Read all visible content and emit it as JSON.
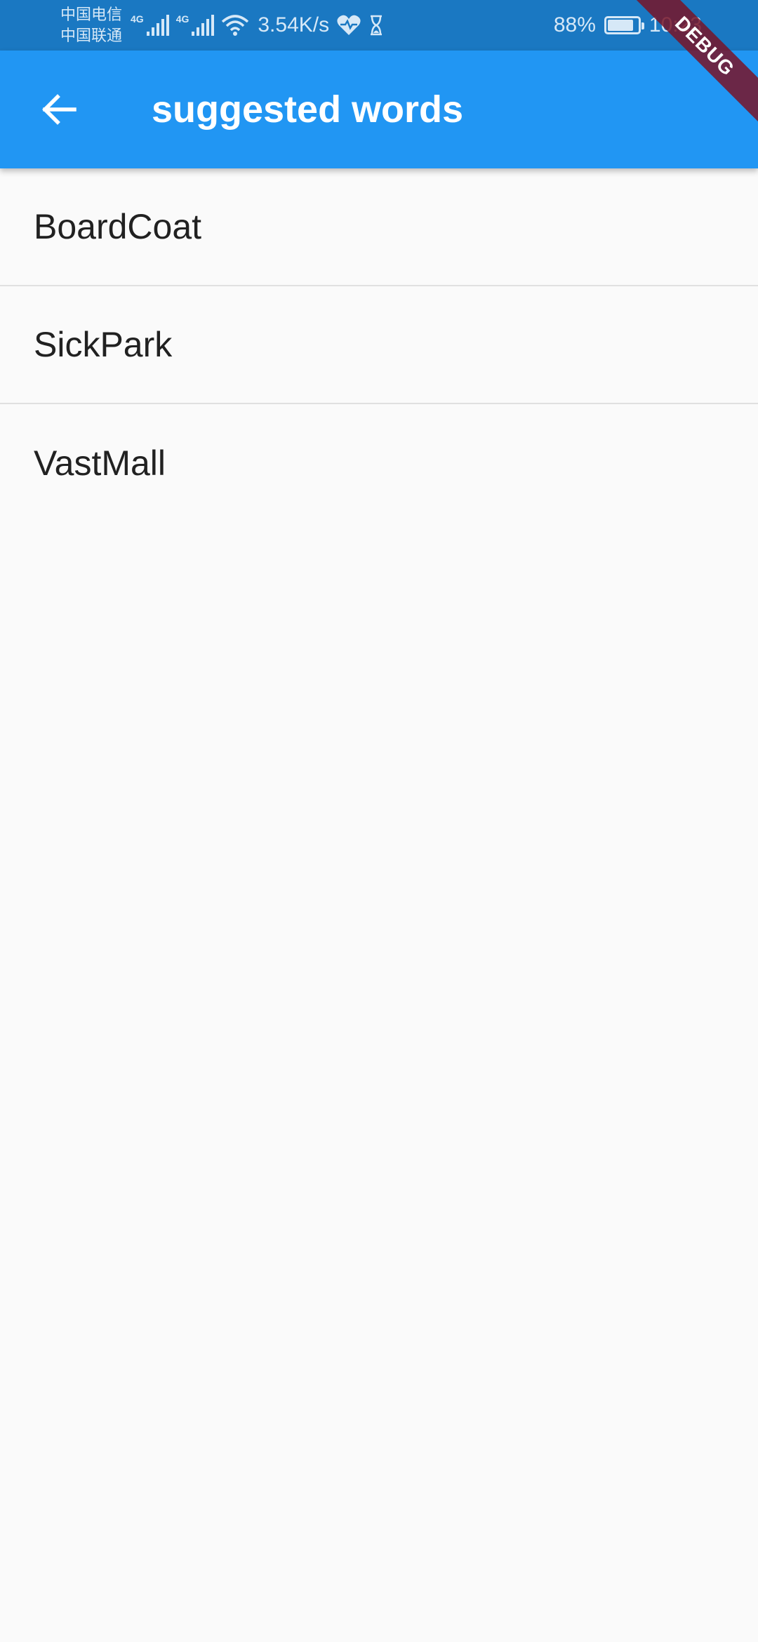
{
  "status_bar": {
    "carrier_1": "中国电信",
    "carrier_2": "中国联通",
    "signal_1_tag": "4G",
    "signal_2_tag": "4G",
    "net_speed": "3.54K/s",
    "battery_text": "88%",
    "battery_level": 0.88,
    "time": "10:23"
  },
  "app_bar": {
    "title": "suggested words",
    "color": "#2196f3"
  },
  "debug_banner": "DEBUG",
  "list": {
    "items": [
      {
        "label": "BoardCoat"
      },
      {
        "label": "SickPark"
      },
      {
        "label": "VastMall"
      }
    ]
  }
}
